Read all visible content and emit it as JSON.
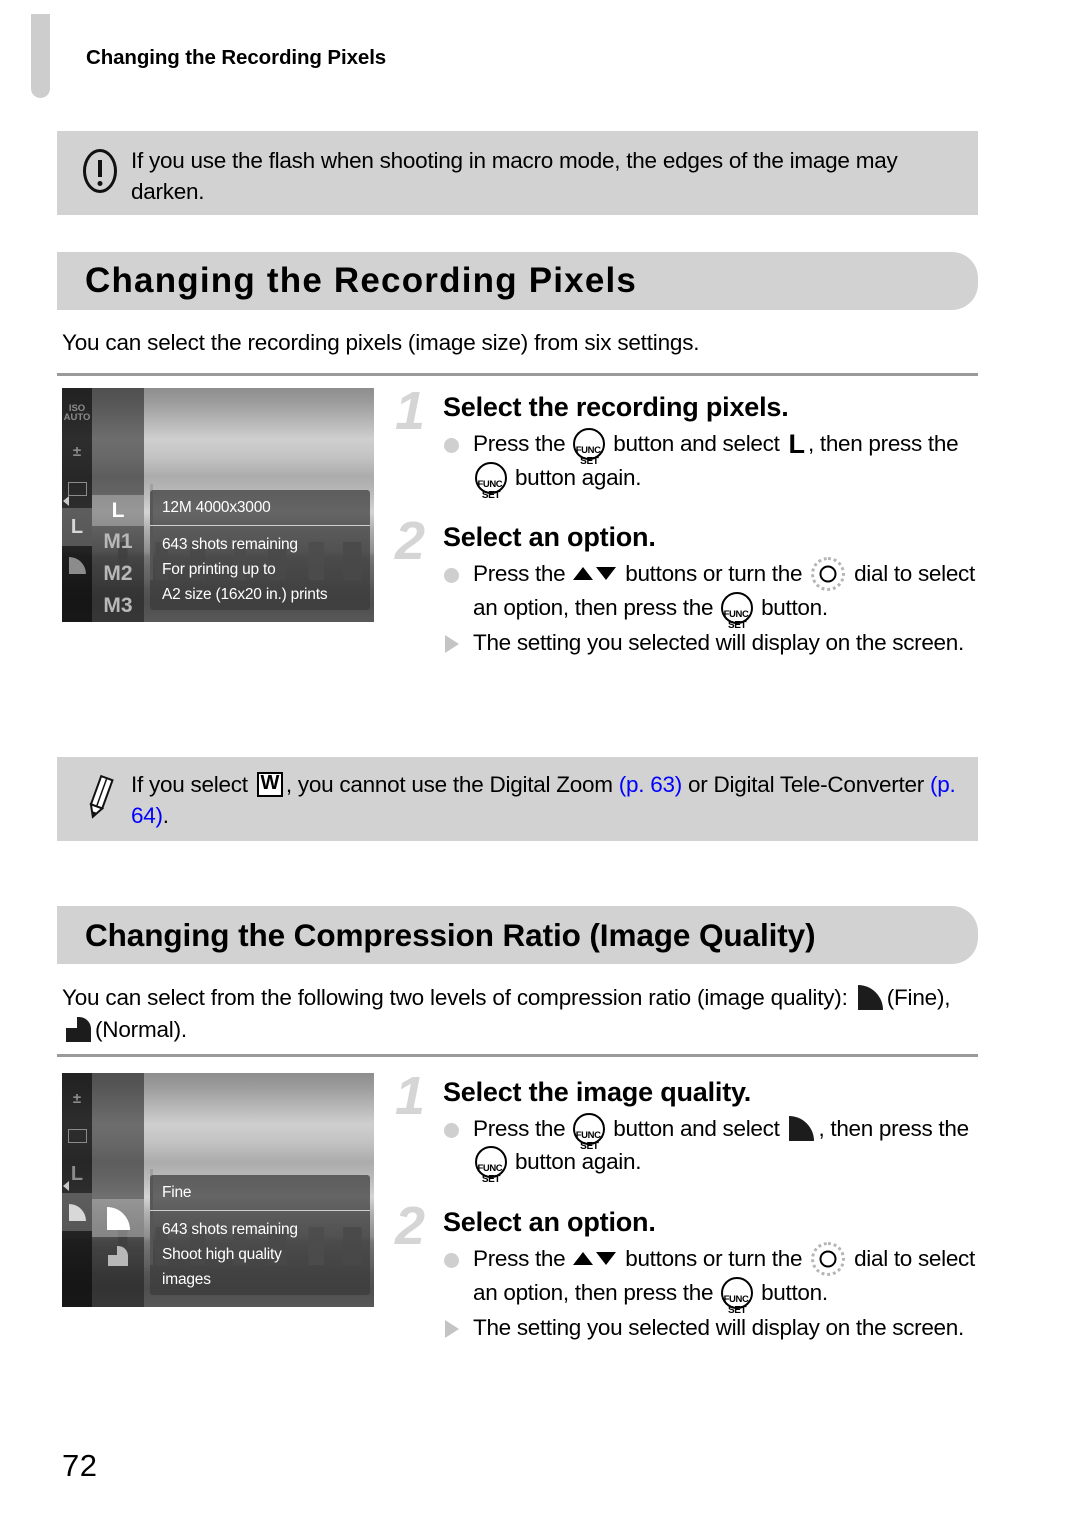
{
  "page": {
    "folio": "72",
    "running_header": "Changing the Recording Pixels",
    "link_color": "#0000ff",
    "callout_bg": "#d2d2d2",
    "heading_bg": "#d2d2d2"
  },
  "warning": {
    "icon": "exclamation-in-ellipse-icon",
    "text": "If you use the flash when shooting in macro mode, the edges of the image may darken."
  },
  "section1": {
    "heading": "Changing the Recording Pixels",
    "intro": "You can select the recording pixels (image size) from six settings.",
    "lcd": {
      "strip_icons": [
        "ISO AUTO",
        "exposure-compensation",
        "white-balance",
        "L",
        "fine"
      ],
      "options": [
        "L",
        "M1",
        "M2",
        "M3"
      ],
      "selected_option": "L",
      "info_title": "12M 4000x3000",
      "info_lines": [
        "643 shots remaining",
        "For printing up to",
        "A2 size (16x20 in.) prints"
      ]
    },
    "steps": [
      {
        "number": "1",
        "title": "Select the recording pixels.",
        "lines": [
          {
            "bullet": "dot",
            "parts": [
              {
                "t": "text",
                "v": "Press the "
              },
              {
                "t": "icon",
                "v": "func-set-button-icon"
              },
              {
                "t": "text",
                "v": " button and select "
              },
              {
                "t": "icon",
                "v": "large-pixels-icon"
              },
              {
                "t": "text",
                "v": ", then press the "
              },
              {
                "t": "icon",
                "v": "func-set-button-icon"
              },
              {
                "t": "text",
                "v": " button again."
              }
            ]
          }
        ]
      },
      {
        "number": "2",
        "title": "Select an option.",
        "lines": [
          {
            "bullet": "dot",
            "parts": [
              {
                "t": "text",
                "v": "Press the "
              },
              {
                "t": "icon",
                "v": "up-down-buttons-icon"
              },
              {
                "t": "text",
                "v": " buttons or turn the "
              },
              {
                "t": "icon",
                "v": "control-dial-icon"
              },
              {
                "t": "text",
                "v": " dial to select an option, then press the "
              },
              {
                "t": "icon",
                "v": "func-set-button-icon"
              },
              {
                "t": "text",
                "v": " button."
              }
            ]
          },
          {
            "bullet": "triangle",
            "parts": [
              {
                "t": "text",
                "v": "The setting you selected will display on the screen."
              }
            ]
          }
        ]
      }
    ]
  },
  "note": {
    "icon": "pencil-icon",
    "segments": [
      {
        "t": "text",
        "v": "If you select "
      },
      {
        "t": "icon",
        "v": "widescreen-w-icon"
      },
      {
        "t": "text",
        "v": ", you cannot use the Digital Zoom "
      },
      {
        "t": "link",
        "v": "(p. 63)"
      },
      {
        "t": "text",
        "v": " or Digital Tele-Converter "
      },
      {
        "t": "link",
        "v": "(p. 64)"
      },
      {
        "t": "text",
        "v": "."
      }
    ],
    "text_plain": "If you select W, you cannot use the Digital Zoom (p. 63) or Digital Tele-Converter (p. 64).",
    "links": [
      "(p. 63)",
      "(p. 64)"
    ]
  },
  "section2": {
    "heading": "Changing the Compression Ratio (Image Quality)",
    "intro_lead": "You can select from the following two levels of compression ratio (image quality): ",
    "intro_fine": "(Fine), ",
    "intro_normal": "(Normal).",
    "lcd": {
      "strip_icons": [
        "exposure-compensation",
        "white-balance",
        "L",
        "fine"
      ],
      "options": [
        "fine",
        "normal"
      ],
      "selected_option": "fine",
      "info_title": "Fine",
      "info_lines": [
        "643 shots remaining",
        "Shoot high quality",
        "images"
      ]
    },
    "steps": [
      {
        "number": "1",
        "title": "Select the image quality.",
        "lines": [
          {
            "bullet": "dot",
            "parts": [
              {
                "t": "text",
                "v": "Press the "
              },
              {
                "t": "icon",
                "v": "func-set-button-icon"
              },
              {
                "t": "text",
                "v": " button and select "
              },
              {
                "t": "icon",
                "v": "fine-quality-icon"
              },
              {
                "t": "text",
                "v": ", then press the "
              },
              {
                "t": "icon",
                "v": "func-set-button-icon"
              },
              {
                "t": "text",
                "v": " button again."
              }
            ]
          }
        ]
      },
      {
        "number": "2",
        "title": "Select an option.",
        "lines": [
          {
            "bullet": "dot",
            "parts": [
              {
                "t": "text",
                "v": "Press the "
              },
              {
                "t": "icon",
                "v": "up-down-buttons-icon"
              },
              {
                "t": "text",
                "v": " buttons or turn the "
              },
              {
                "t": "icon",
                "v": "control-dial-icon"
              },
              {
                "t": "text",
                "v": " dial to select an option, then press the "
              },
              {
                "t": "icon",
                "v": "func-set-button-icon"
              },
              {
                "t": "text",
                "v": " button."
              }
            ]
          },
          {
            "bullet": "triangle",
            "parts": [
              {
                "t": "text",
                "v": "The setting you selected will display on the screen."
              }
            ]
          }
        ]
      }
    ]
  },
  "labels": {
    "func_set_line1": "FUNC.",
    "func_set_line2": "SET",
    "iso_line1": "ISO",
    "iso_line2": "AUTO"
  }
}
